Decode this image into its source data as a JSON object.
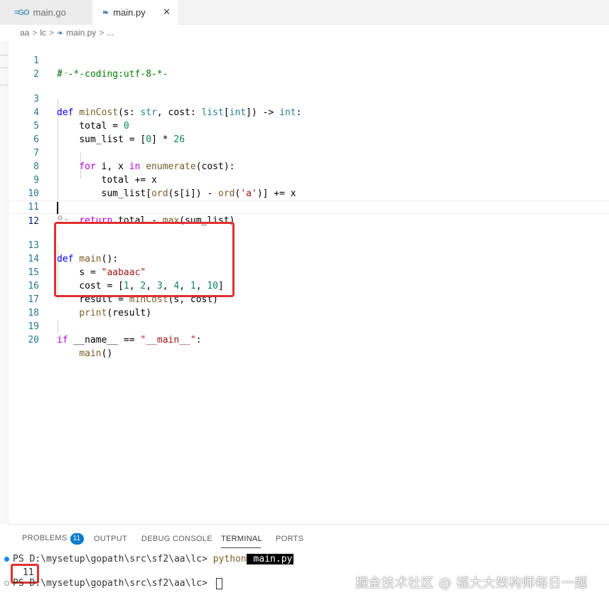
{
  "tabs": [
    {
      "icon": "go-icon",
      "glyph": "=GO",
      "label": "main.go",
      "active": false
    },
    {
      "icon": "python-icon",
      "glyph": "❧",
      "label": "main.py",
      "active": true,
      "close": "✕"
    }
  ],
  "breadcrumb": {
    "items": [
      "aa",
      "lc",
      "main.py",
      "..."
    ],
    "separator": ">"
  },
  "editor": {
    "codelens_icon": "⚙⌄",
    "lines": [
      {
        "n": "1"
      },
      {
        "n": "2"
      },
      {
        "n": "3"
      },
      {
        "n": "4"
      },
      {
        "n": "5"
      },
      {
        "n": "6"
      },
      {
        "n": "7"
      },
      {
        "n": "8"
      },
      {
        "n": "9"
      },
      {
        "n": "10"
      },
      {
        "n": "11"
      },
      {
        "n": "12"
      },
      {
        "n": "13"
      },
      {
        "n": "14"
      },
      {
        "n": "15"
      },
      {
        "n": "16"
      },
      {
        "n": "17"
      },
      {
        "n": "18"
      },
      {
        "n": "19"
      },
      {
        "n": "20"
      }
    ],
    "code": {
      "l1": "# -*-coding:utf-8-*-",
      "l3": {
        "def": "def",
        "name": "minCost",
        "p1": "(s: ",
        "t1": "str",
        "p2": ", cost: ",
        "t2": "list",
        "p3": "[",
        "t3": "int",
        "p4": "]) -> ",
        "t4": "int",
        "p5": ":"
      },
      "l4": {
        "var": "total",
        "op": " = ",
        "num": "0"
      },
      "l5": {
        "var": "sum_list",
        "op": " = [",
        "num": "0",
        "op2": "] * ",
        "num2": "26"
      },
      "l7": {
        "for": "for",
        "a": " i, x ",
        "in": "in",
        "sp": " ",
        "fn": "enumerate",
        "b": "(cost):"
      },
      "l8": {
        "var": "total",
        "rest": " += x"
      },
      "l9": {
        "var": "sum_list",
        "a": "[",
        "fn": "ord",
        "b": "(s[i]) - ",
        "fn2": "ord",
        "c": "(",
        "str": "'a'",
        "d": ")] += x"
      },
      "l11": {
        "ret": "return",
        "a": " total - ",
        "fn": "max",
        "b": "(sum_list)"
      },
      "l13": {
        "def": "def",
        "name": "main",
        "rest": "():"
      },
      "l14": {
        "var": "s",
        "op": " = ",
        "str": "\"aabaac\""
      },
      "l15": {
        "var": "cost",
        "op": " = [",
        "n1": "1",
        "c1": ", ",
        "n2": "2",
        "c2": ", ",
        "n3": "3",
        "c3": ", ",
        "n4": "4",
        "c4": ", ",
        "n5": "1",
        "c5": ", ",
        "n6": "10",
        "end": "]"
      },
      "l16": {
        "var": "result",
        "op": " = ",
        "fn": "minCost",
        "rest": "(s, cost)"
      },
      "l17": {
        "fn": "print",
        "rest": "(result)"
      },
      "l19": {
        "if": "if",
        "a": " ",
        "dunder": "__name__",
        "b": " == ",
        "str": "\"__main__\"",
        "c": ":"
      },
      "l20": {
        "fn": "main",
        "rest": "()"
      }
    }
  },
  "panel": {
    "tabs": [
      "PROBLEMS",
      "OUTPUT",
      "DEBUG CONSOLE",
      "TERMINAL",
      "PORTS"
    ],
    "problems_count": "11",
    "active_tab": "TERMINAL"
  },
  "terminal": {
    "prompt1": "PS D:\\mysetup\\gopath\\src\\sf2\\aa\\lc> ",
    "cmd": "python",
    "cmd_file": " main.py",
    "output": "11",
    "prompt2": "PS D:\\mysetup\\gopath\\src\\sf2\\aa\\lc> "
  },
  "watermark": "掘金技术社区 @ 福大大架构师每日一题",
  "colors": {
    "keyword": "#0000ff",
    "function": "#795e26",
    "type": "#267f99",
    "number": "#098658",
    "string": "#a31515",
    "comment": "#008000",
    "annotation": "#e03030",
    "badge": "#007acc"
  }
}
